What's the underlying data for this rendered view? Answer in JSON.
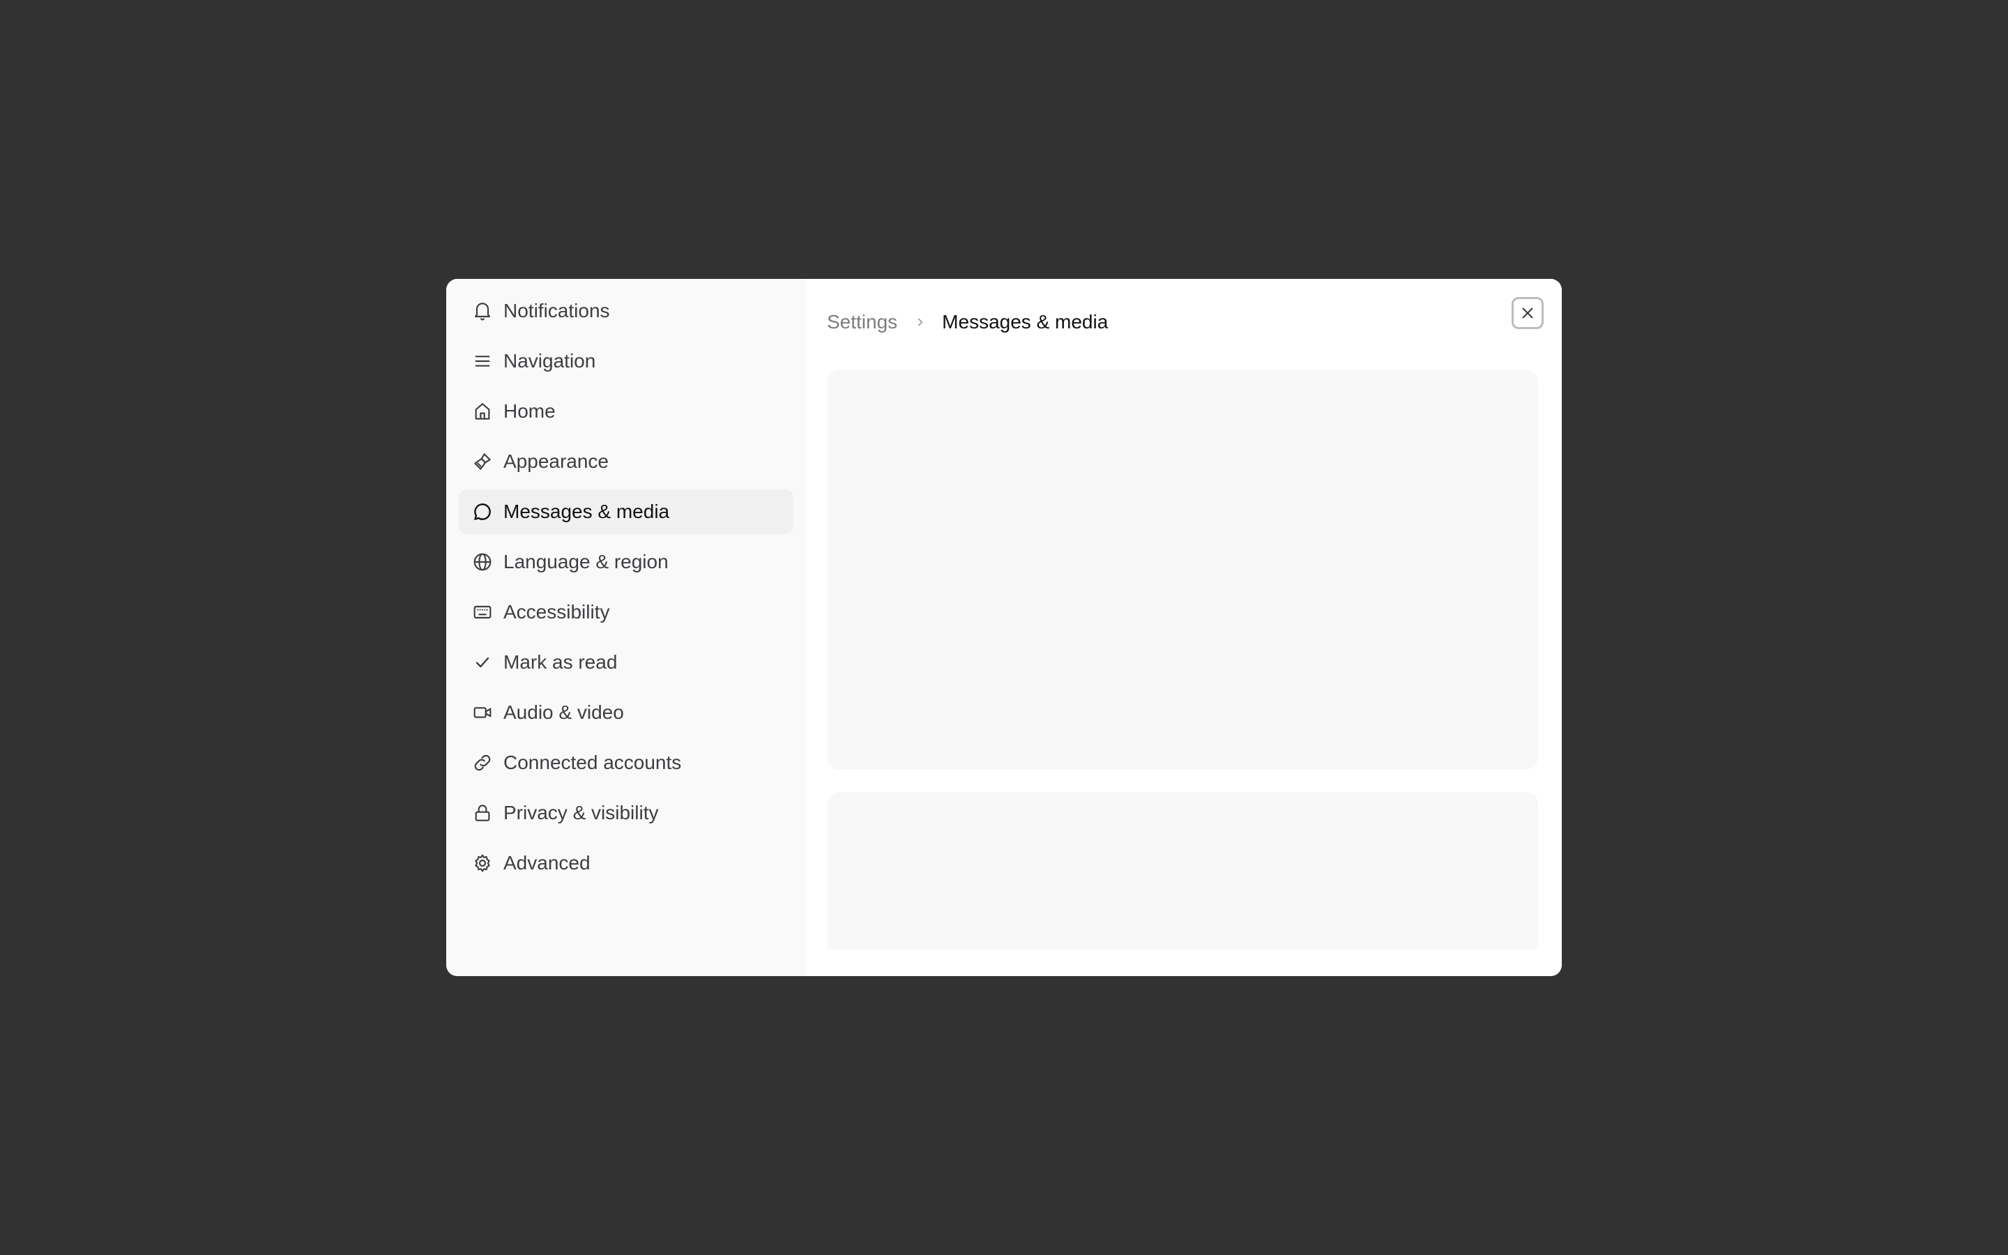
{
  "sidebar": {
    "items": [
      {
        "label": "Notifications",
        "icon": "bell-icon",
        "active": false
      },
      {
        "label": "Navigation",
        "icon": "menu-icon",
        "active": false
      },
      {
        "label": "Home",
        "icon": "home-icon",
        "active": false
      },
      {
        "label": "Appearance",
        "icon": "paintbrush-icon",
        "active": false
      },
      {
        "label": "Messages & media",
        "icon": "message-circle-icon",
        "active": true
      },
      {
        "label": "Language & region",
        "icon": "globe-icon",
        "active": false
      },
      {
        "label": "Accessibility",
        "icon": "keyboard-icon",
        "active": false
      },
      {
        "label": "Mark as read",
        "icon": "check-icon",
        "active": false
      },
      {
        "label": "Audio & video",
        "icon": "video-icon",
        "active": false
      },
      {
        "label": "Connected accounts",
        "icon": "link-icon",
        "active": false
      },
      {
        "label": "Privacy & visibility",
        "icon": "lock-icon",
        "active": false
      },
      {
        "label": "Advanced",
        "icon": "gear-icon",
        "active": false
      }
    ]
  },
  "header": {
    "breadcrumb": {
      "parent": "Settings",
      "separator_icon": "chevron-right-icon",
      "current": "Messages & media"
    },
    "close_icon": "close-icon"
  },
  "colors": {
    "backdrop": "#323232",
    "sidebar_bg": "#f9f9f9",
    "active_item_bg": "#f0f0f0",
    "card_bg": "#f8f8f8",
    "text_primary": "#111111",
    "text_secondary": "#3d3d42",
    "text_muted": "#7c7c7c"
  }
}
